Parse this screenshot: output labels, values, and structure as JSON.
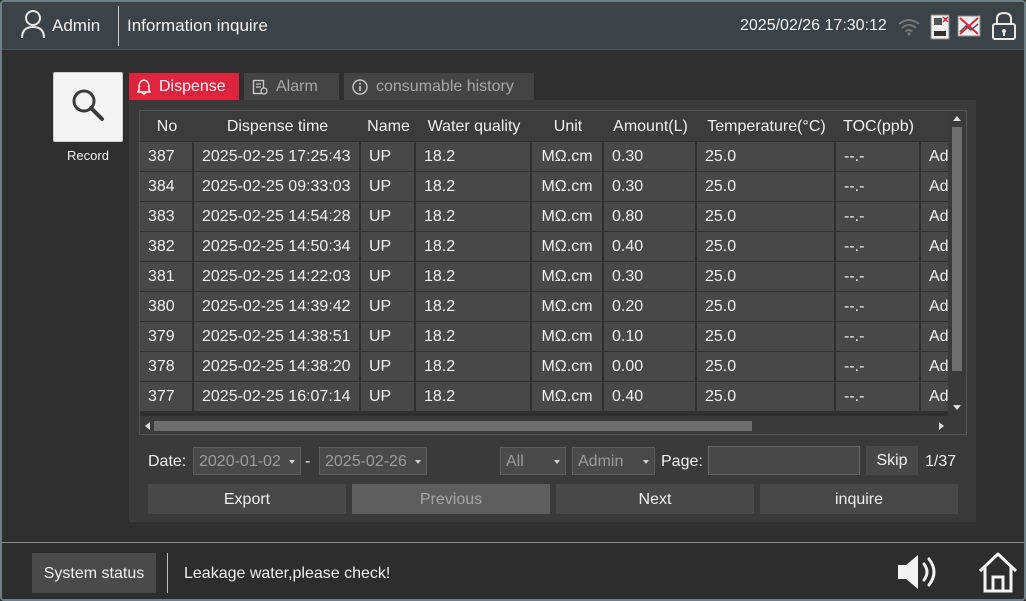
{
  "header": {
    "user_name": "Admin",
    "title": "Information inquire",
    "datetime": "2025/02/26 17:30:12",
    "icons": [
      "user-icon",
      "wifi-icon",
      "network-status-icon",
      "screen-status-icon",
      "lock-icon"
    ]
  },
  "sidebar": {
    "record_label": "Record",
    "record_icon": "magnifier-icon"
  },
  "tabs": [
    {
      "label": "Dispense",
      "icon": "bell-icon",
      "active": true
    },
    {
      "label": "Alarm",
      "icon": "alarm-list-icon",
      "active": false
    },
    {
      "label": "consumable history",
      "icon": "info-icon",
      "active": false
    }
  ],
  "table": {
    "columns": [
      "No",
      "Dispense time",
      "Name",
      "Water quality",
      "Unit",
      "Amount(L)",
      "Temperature(°C)",
      "TOC(ppb)",
      ""
    ],
    "rows": [
      [
        "387",
        "2025-02-25 17:25:43",
        "UP",
        "18.2",
        "MΩ.cm",
        "0.30",
        "25.0",
        "--.-",
        "Ad"
      ],
      [
        "384",
        "2025-02-25 09:33:03",
        "UP",
        "18.2",
        "MΩ.cm",
        "0.30",
        "25.0",
        "--.-",
        "Ad"
      ],
      [
        "383",
        "2025-02-25 14:54:28",
        "UP",
        "18.2",
        "MΩ.cm",
        "0.80",
        "25.0",
        "--.-",
        "Ad"
      ],
      [
        "382",
        "2025-02-25 14:50:34",
        "UP",
        "18.2",
        "MΩ.cm",
        "0.40",
        "25.0",
        "--.-",
        "Ad"
      ],
      [
        "381",
        "2025-02-25 14:22:03",
        "UP",
        "18.2",
        "MΩ.cm",
        "0.30",
        "25.0",
        "--.-",
        "Ad"
      ],
      [
        "380",
        "2025-02-25 14:39:42",
        "UP",
        "18.2",
        "MΩ.cm",
        "0.20",
        "25.0",
        "--.-",
        "Ad"
      ],
      [
        "379",
        "2025-02-25 14:38:51",
        "UP",
        "18.2",
        "MΩ.cm",
        "0.10",
        "25.0",
        "--.-",
        "Ad"
      ],
      [
        "378",
        "2025-02-25 14:38:20",
        "UP",
        "18.2",
        "MΩ.cm",
        "0.00",
        "25.0",
        "--.-",
        "Ad"
      ],
      [
        "377",
        "2025-02-25 16:07:14",
        "UP",
        "18.2",
        "MΩ.cm",
        "0.40",
        "25.0",
        "--.-",
        "Ad"
      ]
    ]
  },
  "filters": {
    "date_label": "Date:",
    "date_from": "2020-01-02",
    "date_separator": "-",
    "date_to": "2025-02-26",
    "type": "All",
    "user": "Admin",
    "page_label": "Page:",
    "page_input_value": "",
    "skip_label": "Skip",
    "page_count": "1/37"
  },
  "actions": {
    "export": "Export",
    "previous": "Previous",
    "next": "Next",
    "inquire": "inquire"
  },
  "footer": {
    "system_status": "System status",
    "message": "Leakage water,please check!",
    "icons": [
      "speaker-icon",
      "home-icon"
    ]
  },
  "colors": {
    "active_tab": "#e0243d",
    "header_bg": "#3b4248",
    "cell_bg": "#484848"
  }
}
